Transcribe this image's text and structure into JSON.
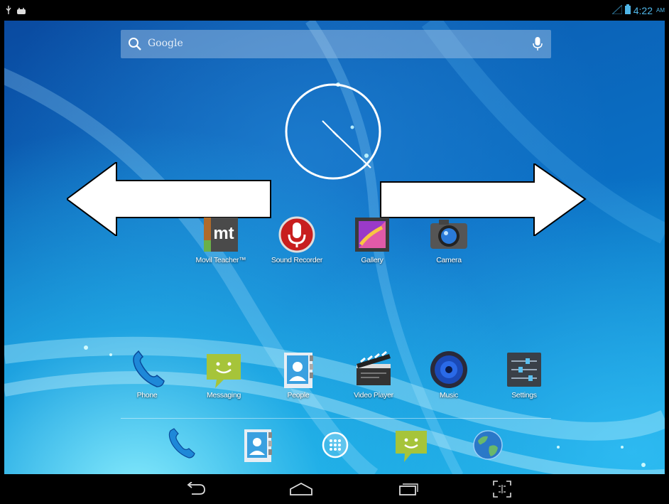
{
  "status_bar": {
    "time": "4:22",
    "ampm": "AM",
    "left_icons": [
      "usb-icon",
      "android-debug-icon"
    ],
    "right_icons": [
      "signal-icon",
      "battery-icon"
    ]
  },
  "search": {
    "placeholder": "Google",
    "icons": [
      "search-icon",
      "mic-icon"
    ]
  },
  "clock": {
    "type": "analog",
    "hour_hand_direction": "toward 4",
    "minute_hand_direction": "toward 4"
  },
  "arrows": [
    "left-arrow",
    "right-arrow"
  ],
  "apps_row1": [
    {
      "label": "Movil Teacher™",
      "icon": "movil-teacher-icon"
    },
    {
      "label": "Sound Recorder",
      "icon": "microphone-icon"
    },
    {
      "label": "Gallery",
      "icon": "gallery-icon"
    },
    {
      "label": "Camera",
      "icon": "camera-icon"
    }
  ],
  "apps_row2": [
    {
      "label": "Phone",
      "icon": "phone-icon"
    },
    {
      "label": "Messaging",
      "icon": "messaging-icon"
    },
    {
      "label": "People",
      "icon": "people-icon"
    },
    {
      "label": "Video Player",
      "icon": "clapperboard-icon"
    },
    {
      "label": "Music",
      "icon": "speaker-icon"
    },
    {
      "label": "Settings",
      "icon": "settings-sliders-icon"
    }
  ],
  "dock": [
    "phone-icon",
    "people-icon",
    "all-apps-icon",
    "messaging-icon",
    "browser-globe-icon"
  ],
  "nav": [
    "back-icon",
    "home-icon",
    "recent-apps-icon",
    "screenshot-icon"
  ],
  "colors": {
    "accent": "#4fb6e8",
    "wallpaper_deep": "#0a4aa0",
    "wallpaper_light": "#12a5d9"
  }
}
